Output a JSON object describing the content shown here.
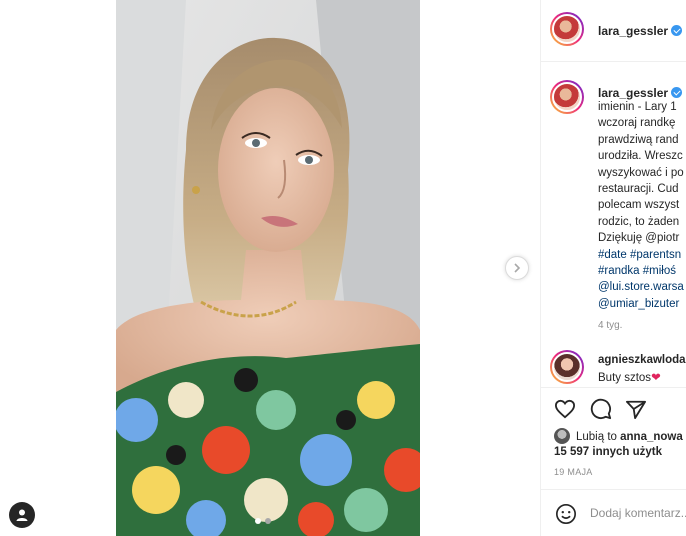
{
  "post": {
    "author": "lara_gessler",
    "caption_lines": [
      "imienin - Lary 1",
      "wczoraj randkę",
      "prawdziwą rand",
      "urodziła. Wreszc",
      "wyszykować i po",
      "restauracji. Cud",
      "polecam wszyst",
      "rodzic, to żaden",
      "Dziękuję @piotr"
    ],
    "hashtag_lines": [
      "#date #parentsn",
      "#randka #miłoś",
      "@lui.store.warsa",
      "@umiar_bizuter"
    ],
    "time_ago": "4 tyg.",
    "comment": {
      "user": "agnieszkawloda",
      "text": "Buty sztos",
      "emoji": "❤"
    },
    "likes_prefix": "Lubią to",
    "likes_user": "anna_nowa",
    "likes_count": "15 597 innych użytk",
    "date": "19 MAJA",
    "comment_placeholder": "Dodaj komentarz..."
  },
  "carousel": {
    "total": 2,
    "active_index": 0
  },
  "icons": [
    "like-icon",
    "comment-icon",
    "share-icon",
    "emoji-icon",
    "next-arrow-icon",
    "user-icon",
    "verified-icon"
  ],
  "colors": {
    "link": "#00376b",
    "verified": "#3897f0",
    "muted": "#8e8e8e"
  }
}
